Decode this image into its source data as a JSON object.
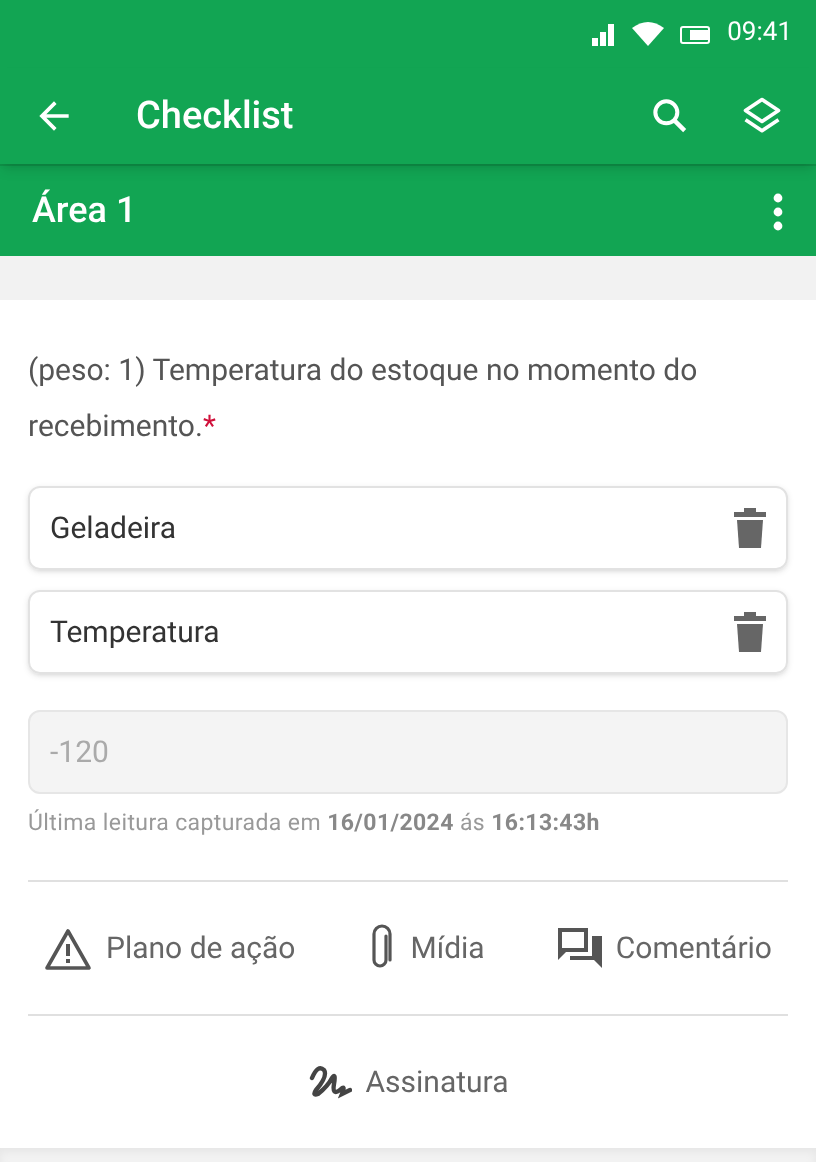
{
  "status_bar": {
    "time": "09:41"
  },
  "app_bar": {
    "title": "Checklist"
  },
  "section": {
    "title": "Área 1"
  },
  "question": {
    "text": "(peso: 1) Temperatura do estoque no momento do recebimento.",
    "required_mark": "*"
  },
  "fields": [
    {
      "value": "Geladeira"
    },
    {
      "value": "Temperatura"
    }
  ],
  "reading": {
    "value": "-120",
    "disabled": true,
    "note": "Última leitura capturada em **16/01/2024** ás **16:13:43h**"
  },
  "actions": [
    {
      "kind": "action_plan",
      "label": "Plano de ação"
    },
    {
      "kind": "media",
      "label": "Mídia"
    },
    {
      "kind": "comment",
      "label": "Comentário"
    }
  ],
  "signature": {
    "kind": "signature",
    "label": "Assinatura"
  }
}
